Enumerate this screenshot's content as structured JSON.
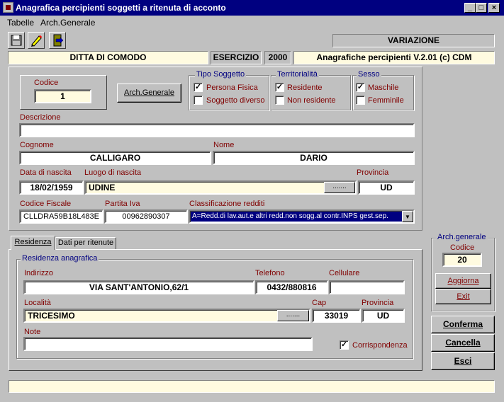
{
  "window": {
    "title": "Anagrafica percipienti soggetti a ritenuta di acconto",
    "min": "_",
    "max": "□",
    "close": "×"
  },
  "menu": [
    {
      "label": "Tabelle"
    },
    {
      "label": "Arch.Generale"
    }
  ],
  "toolbar": {
    "icons": [
      "save-icon",
      "edit-icon",
      "exit-door-icon"
    ]
  },
  "status_mode": "VARIAZIONE",
  "info": {
    "ditta": "DITTA DI COMODO",
    "esercizio_label": "ESERCIZIO",
    "esercizio": "2000",
    "version": "Anagrafiche percipienti V.2.01 (c) CDM"
  },
  "codice": {
    "label": "Codice",
    "value": "1"
  },
  "arch_generale_button": "Arch.Generale",
  "tipo_soggetto": {
    "title": "Tipo Soggetto",
    "options": [
      {
        "label": "Persona Fisica",
        "checked": true
      },
      {
        "label": "Soggetto diverso",
        "checked": false
      }
    ]
  },
  "territorialita": {
    "title": "Territorialità",
    "options": [
      {
        "label": "Residente",
        "checked": true
      },
      {
        "label": "Non residente",
        "checked": false
      }
    ]
  },
  "sesso": {
    "title": "Sesso",
    "options": [
      {
        "label": "Maschile",
        "checked": true
      },
      {
        "label": "Femminile",
        "checked": false
      }
    ]
  },
  "descrizione": {
    "label": "Descrizione",
    "value": ""
  },
  "cognome": {
    "label": "Cognome",
    "value": "CALLIGARO"
  },
  "nome": {
    "label": "Nome",
    "value": "DARIO"
  },
  "data_nascita": {
    "label": "Data di nascita",
    "value": "18/02/1959"
  },
  "luogo_nascita": {
    "label": "Luogo di nascita",
    "value": "UDINE",
    "button": "......."
  },
  "provincia_nascita": {
    "label": "Provincia",
    "value": "UD"
  },
  "codice_fiscale": {
    "label": "Codice Fiscale",
    "value": "CLLDRA59B18L483E"
  },
  "partita_iva": {
    "label": "Partita Iva",
    "value": "00962890307"
  },
  "classificazione": {
    "label": "Classificazione redditi",
    "value": "A=Redd.di lav.aut.e altri redd.non sogg.al contr.INPS gest.sep."
  },
  "tabs": [
    {
      "label": "Residenza"
    },
    {
      "label": "Dati per ritenute"
    }
  ],
  "residenza": {
    "title": "Residenza anagrafica",
    "indirizzo": {
      "label": "Indirizzo",
      "value": "VIA SANT'ANTONIO,62/1"
    },
    "telefono": {
      "label": "Telefono",
      "value": "0432/880816"
    },
    "cellulare": {
      "label": "Cellulare",
      "value": ""
    },
    "localita": {
      "label": "Località",
      "value": "TRICESIMO",
      "button": "......."
    },
    "cap": {
      "label": "Cap",
      "value": "33019"
    },
    "provincia": {
      "label": "Provincia",
      "value": "UD"
    },
    "note": {
      "label": "Note",
      "value": ""
    },
    "corrispondenza": {
      "label": "Corrispondenza",
      "checked": true
    }
  },
  "arch_panel": {
    "title": "Arch.generale",
    "codice_label": "Codice",
    "codice_value": "20",
    "aggiorna": "Aggiorna",
    "exit": "Exit"
  },
  "actions": {
    "conferma": "Conferma",
    "cancella": "Cancella",
    "esci": "Esci"
  },
  "statusbar": ""
}
